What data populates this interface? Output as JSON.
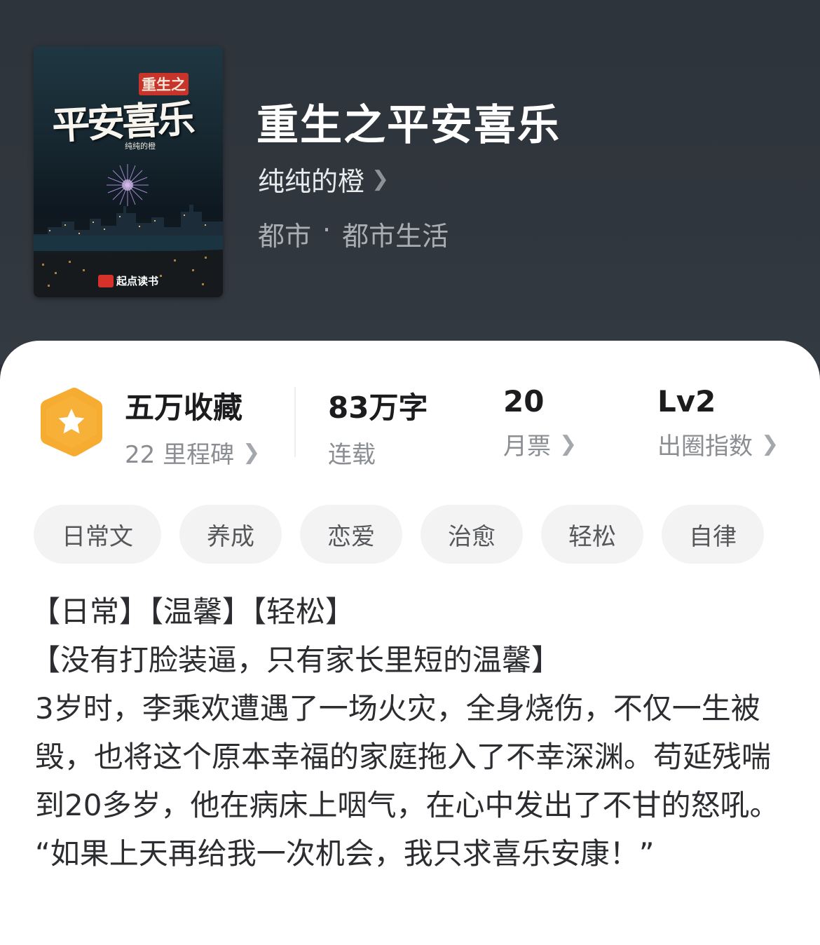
{
  "book": {
    "cover": {
      "subtitle": "重生之",
      "title": "平安喜乐",
      "author": "纯纯的橙",
      "publisher": "起点读书"
    },
    "title": "重生之平安喜乐",
    "author": "纯纯的橙",
    "genre_main": "都市",
    "genre_separator": "·",
    "genre_sub": "都市生活"
  },
  "stats": {
    "collection_label": "五万收藏",
    "milestone_label": "22 里程碑",
    "word_count": "83万字",
    "status": "连载",
    "monthly_votes": "20",
    "monthly_votes_label": "月票",
    "level": "Lv2",
    "level_label": "出圈指数"
  },
  "tags": [
    "日常文",
    "养成",
    "恋爱",
    "治愈",
    "轻松",
    "自律"
  ],
  "description": [
    "【日常】【温馨】【轻松】",
    "【没有打脸装逼，只有家长里短的温馨】",
    "3岁时，李乘欢遭遇了一场火灾，全身烧伤，不仅一生被毁，也将这个原本幸福的家庭拖入了不幸深渊。苟延残喘到20多岁，他在病床上咽气，在心中发出了不甘的怒吼。",
    "“如果上天再给我一次机会，我只求喜乐安康！”"
  ],
  "icons": {
    "author_chevron": "chevron-right-icon",
    "badge": "star-hexagon-icon"
  },
  "colors": {
    "header_bg": "#30363d",
    "badge_orange": "#f5a623",
    "tag_bg": "#f3f3f3"
  }
}
